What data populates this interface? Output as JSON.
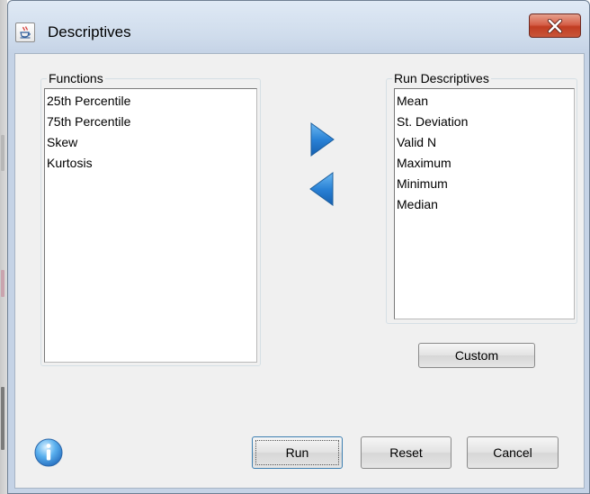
{
  "window": {
    "title": "Descriptives"
  },
  "functions_panel": {
    "label": "Functions",
    "items": [
      "25th Percentile",
      "75th Percentile",
      "Skew",
      "Kurtosis"
    ]
  },
  "run_panel": {
    "label": "Run Descriptives",
    "items": [
      "Mean",
      "St. Deviation",
      "Valid N",
      "Maximum",
      "Minimum",
      "Median"
    ]
  },
  "buttons": {
    "custom": "Custom",
    "run": "Run",
    "reset": "Reset",
    "cancel": "Cancel"
  },
  "icons": {
    "app": "java-cup-icon",
    "close": "close-icon",
    "move_right": "arrow-right-icon",
    "move_left": "arrow-left-icon",
    "info": "info-icon"
  },
  "colors": {
    "arrow_blue": "#2a7fd0",
    "close_red": "#c8553a",
    "dialog_bg": "#f0f0f0"
  }
}
